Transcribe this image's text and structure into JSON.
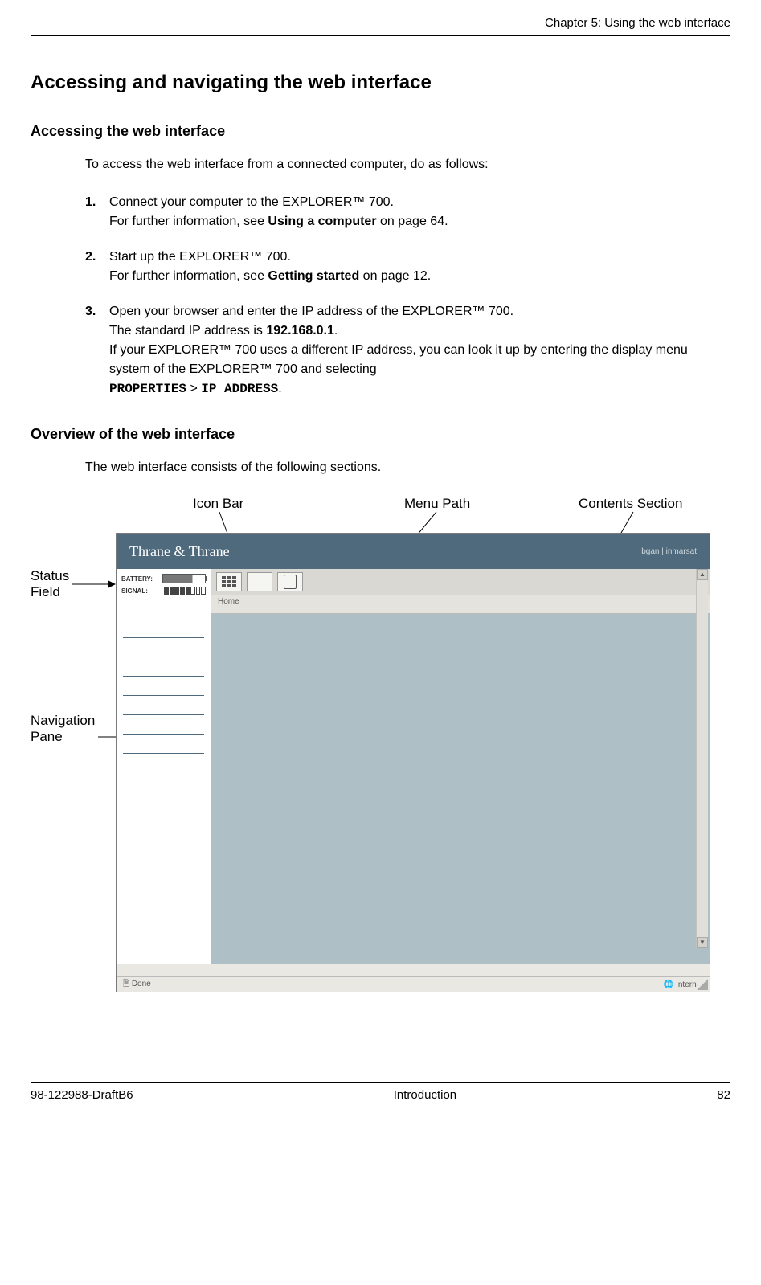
{
  "running_head": "Chapter 5: Using the web interface",
  "h1": "Accessing and navigating the web interface",
  "sec1": {
    "title": "Accessing the web interface",
    "intro": "To access the web interface from a connected computer, do as follows:",
    "steps": [
      {
        "num": "1.",
        "line1": "Connect your computer to the EXPLORER™ 700.",
        "line2_pre": "For further information, see ",
        "line2_bold": "Using a computer",
        "line2_post": " on page 64."
      },
      {
        "num": "2.",
        "line1": "Start up the EXPLORER™ 700.",
        "line2_pre": "For further information, see ",
        "line2_bold": "Getting started",
        "line2_post": " on page 12."
      },
      {
        "num": "3.",
        "line1": "Open your browser and enter the IP address of the EXPLORER™ 700.",
        "line2_pre": "The standard IP address is ",
        "line2_bold": "192.168.0.1",
        "line2_post": ".",
        "line3": "If your EXPLORER™ 700 uses a different IP address, you can look it up by entering the display menu system of the EXPLORER™ 700 and selecting",
        "line4_m1": "PROPERTIES",
        "line4_sep": " > ",
        "line4_m2": "IP ADDRESS",
        "line4_post": "."
      }
    ]
  },
  "sec2": {
    "title": "Overview of the web interface",
    "intro": "The web interface consists of the following sections."
  },
  "callouts": {
    "icon_bar": "Icon Bar",
    "menu_path": "Menu Path",
    "contents_section": "Contents Section",
    "status_field": "Status\nField",
    "navigation_pane": "Navigation\nPane"
  },
  "screenshot": {
    "brand": "Thrane & Thrane",
    "brand_right": "bgan | inmarsat",
    "status": {
      "battery_label": "BATTERY:",
      "signal_label": "SIGNAL:"
    },
    "menu_path_text": "Home",
    "statusbar_left": "Done",
    "statusbar_right": "Internet"
  },
  "footer": {
    "left": "98-122988-DraftB6",
    "center": "Introduction",
    "right": "82"
  }
}
